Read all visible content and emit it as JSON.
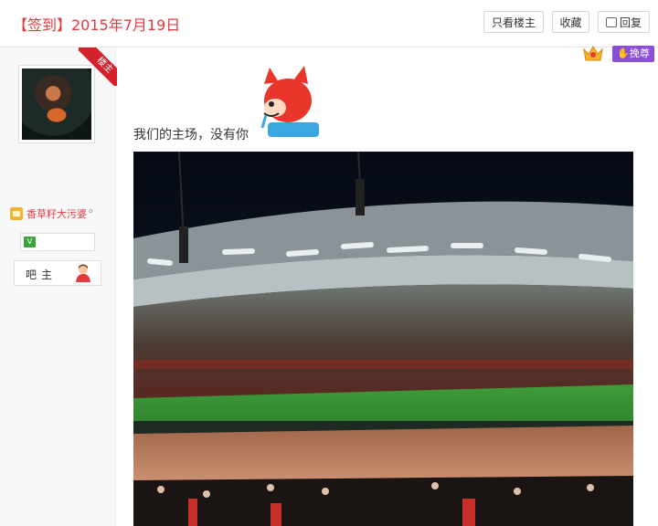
{
  "header": {
    "title": "【签到】2015年7月19日",
    "buttons": {
      "only_owner": "只看楼主",
      "favorite": "收藏",
      "reply": "回复"
    }
  },
  "sidebar": {
    "corner_badge": "楼主",
    "username": "香草籽大污婆",
    "username_mark": "o",
    "vip_badge": "V",
    "role_label": "吧主"
  },
  "badges": {
    "guard_label": "挽尊"
  },
  "post": {
    "text": "我们的主场，没有你"
  },
  "colors": {
    "accent_red": "#e4393c",
    "corner_red": "#d3222c",
    "guard_purple": "#8b4fd6",
    "vip_green": "#3ba43b"
  }
}
